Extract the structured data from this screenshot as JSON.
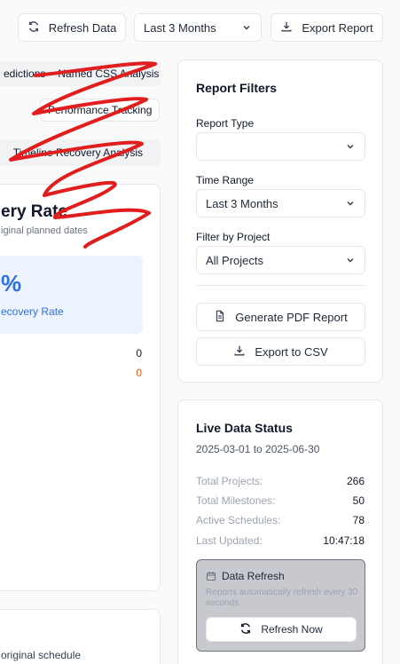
{
  "toolbar": {
    "refresh_label": "Refresh Data",
    "period_value": "Last 3 Months",
    "export_label": "Export Report"
  },
  "tabs": {
    "predictions": "edictions",
    "named_css": "Named CSS Analysis",
    "performance": "Performance Tracking",
    "timeline": "Timeline Recovery Analysis"
  },
  "left_card": {
    "title": "ery Rate",
    "subtitle": "iginal planned dates",
    "stat_value": "%",
    "stat_label": "ecovery Rate",
    "value_a": "0",
    "value_b": "0",
    "bottom_text": "original schedule"
  },
  "filters": {
    "title": "Report Filters",
    "report_type_label": "Report Type",
    "report_type_value": "",
    "time_range_label": "Time Range",
    "time_range_value": "Last 3 Months",
    "project_label": "Filter by Project",
    "project_value": "All Projects",
    "pdf_label": "Generate PDF Report",
    "csv_label": "Export to CSV"
  },
  "live": {
    "title": "Live Data Status",
    "range": "2025-03-01 to 2025-06-30",
    "rows": [
      {
        "k": "Total Projects:",
        "v": "266"
      },
      {
        "k": "Total Milestones:",
        "v": "50"
      },
      {
        "k": "Active Schedules:",
        "v": "78"
      },
      {
        "k": "Last Updated:",
        "v": "10:47:18"
      }
    ],
    "refresh_box_title": "Data Refresh",
    "refresh_box_text": "Reports automatically refresh every 30 seconds",
    "refresh_now_label": "Refresh Now"
  },
  "colors": {
    "accent_blue": "#2f6fe4",
    "orange": "#ea580c",
    "scribble_red": "#e11d1d"
  }
}
